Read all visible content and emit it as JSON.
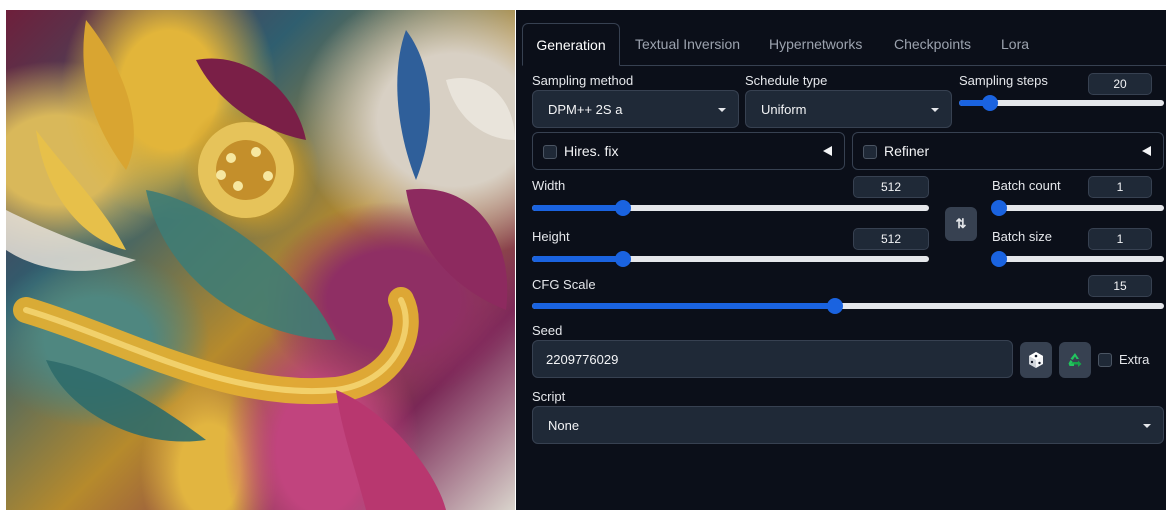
{
  "tabs": [
    {
      "label": "Generation",
      "active": true
    },
    {
      "label": "Textual Inversion"
    },
    {
      "label": "Hypernetworks"
    },
    {
      "label": "Checkpoints"
    },
    {
      "label": "Lora"
    }
  ],
  "sampling": {
    "method_label": "Sampling method",
    "method_value": "DPM++ 2S a",
    "schedule_label": "Schedule type",
    "schedule_value": "Uniform",
    "steps_label": "Sampling steps",
    "steps_value": "20",
    "steps_fraction": 0.15
  },
  "hires": {
    "label": "Hires. fix",
    "checked": false
  },
  "refiner": {
    "label": "Refiner",
    "checked": false
  },
  "width": {
    "label": "Width",
    "value": "512",
    "fraction": 0.23
  },
  "height": {
    "label": "Height",
    "value": "512",
    "fraction": 0.23
  },
  "batch_count": {
    "label": "Batch count",
    "value": "1",
    "fraction": 0.0
  },
  "batch_size": {
    "label": "Batch size",
    "value": "1",
    "fraction": 0.0
  },
  "swap_icon": "swap-vertical-arrows",
  "cfg": {
    "label": "CFG Scale",
    "value": "15",
    "fraction": 0.48
  },
  "seed": {
    "label": "Seed",
    "value": "2209776029",
    "random_icon": "dice-icon",
    "reuse_icon": "recycle-icon",
    "extra_label": "Extra"
  },
  "script": {
    "label": "Script",
    "value": "None"
  },
  "colors": {
    "accent": "#1a63e0",
    "panel_bg": "#0b0f19",
    "input_bg": "#1f2937",
    "border": "#374151"
  }
}
